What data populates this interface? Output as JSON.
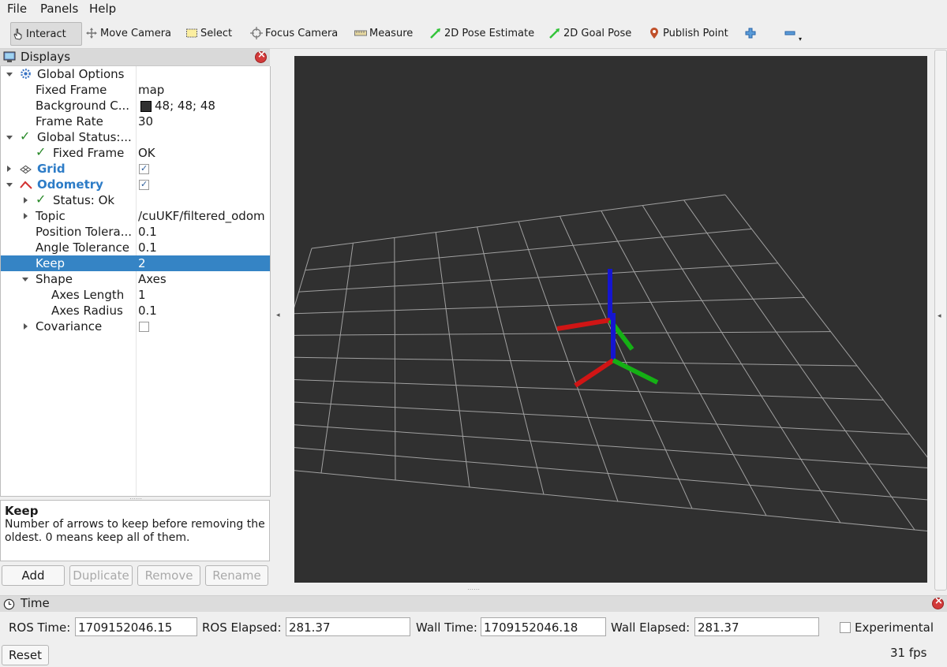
{
  "menubar": {
    "items": [
      "File",
      "Panels",
      "Help"
    ]
  },
  "toolbar": {
    "tools": [
      "Interact",
      "Move Camera",
      "Select",
      "Focus Camera",
      "Measure",
      "2D Pose Estimate",
      "2D Goal Pose",
      "Publish Point"
    ]
  },
  "displays": {
    "title": "Displays",
    "rows": [
      {
        "name": "Global Options",
        "value": ""
      },
      {
        "name": "Fixed Frame",
        "value": "map"
      },
      {
        "name": "Background C...",
        "value": "48; 48; 48"
      },
      {
        "name": "Frame Rate",
        "value": "30"
      },
      {
        "name": "Global Status:...",
        "value": ""
      },
      {
        "name": "Fixed Frame",
        "value": "OK"
      },
      {
        "name": "Grid",
        "value": ""
      },
      {
        "name": "Odometry",
        "value": ""
      },
      {
        "name": "Status: Ok",
        "value": ""
      },
      {
        "name": "Topic",
        "value": "/cuUKF/filtered_odom"
      },
      {
        "name": "Position Tolera...",
        "value": "0.1"
      },
      {
        "name": "Angle Tolerance",
        "value": "0.1"
      },
      {
        "name": "Keep",
        "value": "2"
      },
      {
        "name": "Shape",
        "value": "Axes"
      },
      {
        "name": "Axes Length",
        "value": "1"
      },
      {
        "name": "Axes Radius",
        "value": "0.1"
      },
      {
        "name": "Covariance",
        "value": ""
      }
    ],
    "grid_checked": true,
    "odometry_checked": true,
    "covariance_checked": false,
    "background_color": "#303030"
  },
  "description": {
    "title": "Keep",
    "text": "Number of arrows to keep before removing the oldest. 0 means keep all of them."
  },
  "buttons": {
    "add": "Add",
    "duplicate": "Duplicate",
    "remove": "Remove",
    "rename": "Rename"
  },
  "time": {
    "title": "Time",
    "ros_time_label": "ROS Time:",
    "ros_time": "1709152046.15",
    "ros_elapsed_label": "ROS Elapsed:",
    "ros_elapsed": "281.37",
    "wall_time_label": "Wall Time:",
    "wall_time": "1709152046.18",
    "wall_elapsed_label": "Wall Elapsed:",
    "wall_elapsed": "281.37",
    "experimental_label": "Experimental",
    "reset": "Reset",
    "fps": "31 fps"
  }
}
